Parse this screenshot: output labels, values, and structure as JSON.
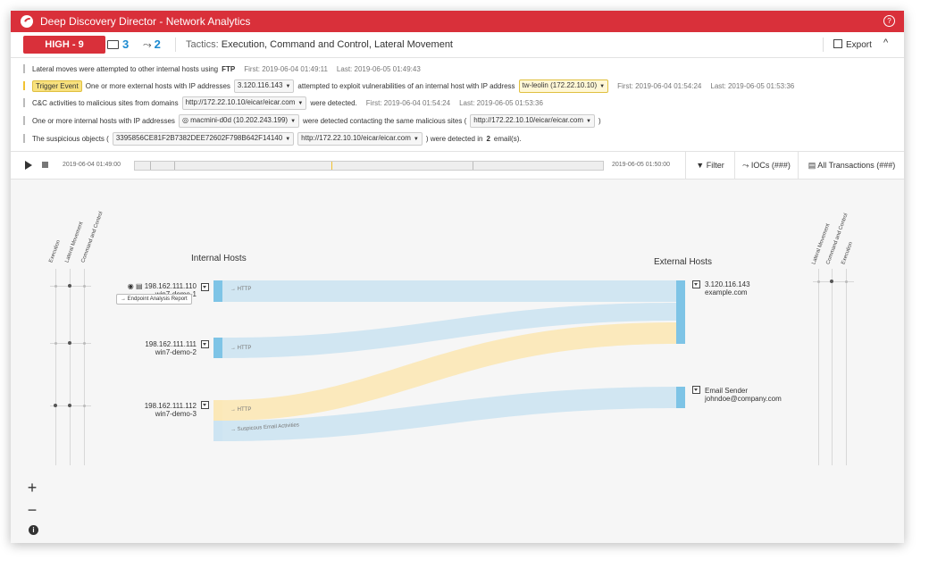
{
  "window": {
    "title": "Deep Discovery Director - Network Analytics",
    "help_icon": "?"
  },
  "header": {
    "severity": "HIGH - 9",
    "hosts_count": "3",
    "lateral_count": "2",
    "tactics_label": "Tactics:",
    "tactics_value": "Execution, Command and Control, Lateral Movement",
    "export_label": "Export",
    "collapse_glyph": "^"
  },
  "events": [
    {
      "text": "Lateral moves were attempted to other internal hosts using",
      "protocol": "FTP",
      "first": "First:  2019-06-04 01:49:11",
      "last": "Last:  2019-06-05 01:49:43"
    },
    {
      "trigger": "Trigger Event",
      "text1": "One or more external hosts with IP addresses",
      "ip": "3.120.116.143",
      "text2": "attempted to exploit vulnerabilities of an internal host with IP address",
      "host": "tw-leolin (172.22.10.10)",
      "first": "First:  2019-06-04 01:54:24",
      "last": "Last:  2019-06-05 01:53:36"
    },
    {
      "text1": "C&C activities to malicious sites from domains",
      "url": "http://172.22.10.10/eicar/eicar.com",
      "text2": "were detected.",
      "first": "First:  2019-06-04 01:54:24",
      "last": "Last:  2019-06-05 01:53:36"
    },
    {
      "text1": "One or more internal hosts with IP addresses",
      "host": "macmini-d0d (10.202.243.199)",
      "text2": "were detected contacting the same malicious sites (",
      "url": "http://172.22.10.10/eicar/eicar.com",
      "text3": ")"
    },
    {
      "text1": "The suspicious objects (",
      "hash": "3395856CE81F2B7382DEE72602F798B642F14140",
      "url": "http://172.22.10.10/eicar/eicar.com",
      "text2": ") were detected in",
      "count": "2",
      "text3": "email(s)."
    }
  ],
  "timeline": {
    "start": "2019-06-04 01:49:00",
    "end": "2019-06-05 01:50:00",
    "filter_label": "Filter",
    "iocs_label": "IOCs (###)",
    "transactions_label": "All Transactions (###)",
    "marker_color": "#f1c232",
    "accent": "#1c8ad0",
    "danger": "#d9303a"
  },
  "graph": {
    "left_tactics": [
      "Execution",
      "Lateral Movement",
      "Command and Control"
    ],
    "right_tactics": [
      "Lateral Movement",
      "Command and Control",
      "Execution"
    ],
    "internal_title": "Internal Hosts",
    "external_title": "External Hosts",
    "internal_hosts": [
      {
        "ip": "198.162.111.110",
        "name": "win7-demo-1",
        "flows": [
          "→ HTTP"
        ]
      },
      {
        "ip": "198.162.111.111",
        "name": "win7-demo-2",
        "flows": [
          "→ HTTP"
        ]
      },
      {
        "ip": "198.162.111.112",
        "name": "win7-demo-3",
        "flows": [
          "→ HTTP",
          "→ Suspicous Email Activities"
        ]
      }
    ],
    "external_hosts": [
      {
        "ip": "3.120.116.143",
        "name": "example.com"
      },
      {
        "ip": "Email Sender",
        "name": "johndoe@company.com"
      }
    ],
    "report_button": "Endpoint Analysis Report",
    "flow_colors": {
      "blue": "#cde4f2",
      "yellow": "#fbe8b8",
      "node": "#7ec4e6"
    }
  },
  "controls": {
    "zoom_in": "+",
    "zoom_out": "−",
    "info": "i"
  }
}
